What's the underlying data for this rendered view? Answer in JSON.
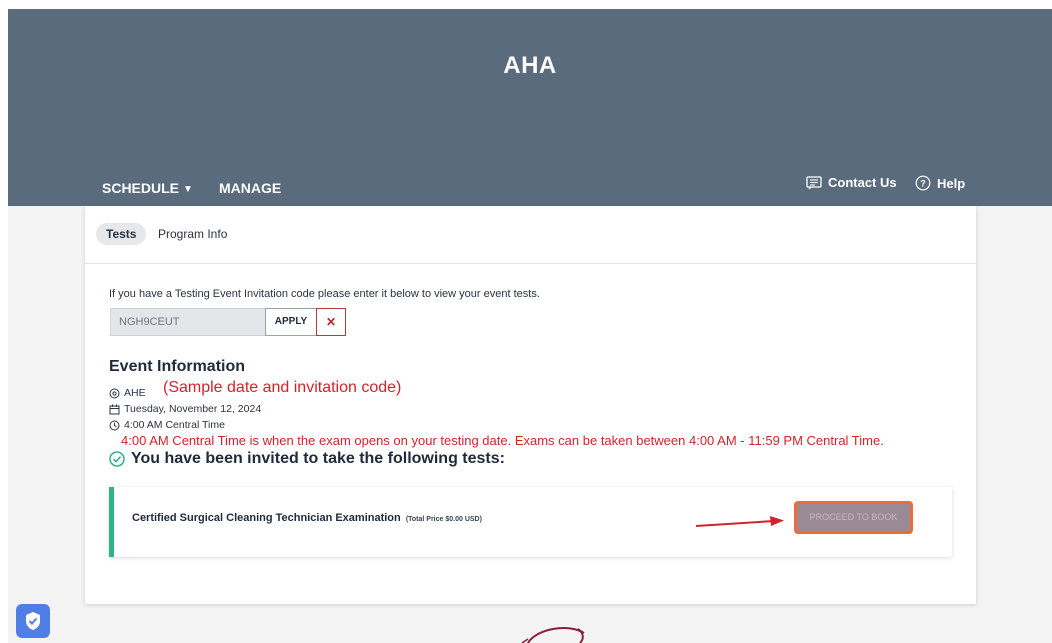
{
  "brand": "AHA",
  "nav": {
    "schedule": "SCHEDULE",
    "manage": "MANAGE",
    "contact": "Contact Us",
    "help": "Help"
  },
  "tabs": {
    "tests": "Tests",
    "program_info": "Program Info"
  },
  "invite": {
    "prompt": "If you have a Testing Event Invitation code please enter it below to view your event tests.",
    "code_value": "NGH9CEUT",
    "apply": "APPLY",
    "clear": "✕"
  },
  "event": {
    "title": "Event Information",
    "location": "AHE",
    "date": "Tuesday, November 12, 2024",
    "time": "4:00 AM Central Time",
    "sample_note": "(Sample date and invitation code)",
    "time_note": "4:00 AM Central Time is when the exam opens on your testing date. Exams can be taken between 4:00 AM - 11:59 PM Central Time.",
    "invited_heading": "You have been invited to take the following tests:"
  },
  "exam": {
    "name": "Certified Surgical Cleaning Technician Examination",
    "price": "(Total Price $0.00 USD)",
    "proceed": "PROCEED TO BOOK"
  },
  "colors": {
    "header_bg": "#5a6b7d",
    "accent_green": "#2fb38a",
    "annotation_red": "#d3232a",
    "highlight_orange": "#ef6b3a"
  }
}
